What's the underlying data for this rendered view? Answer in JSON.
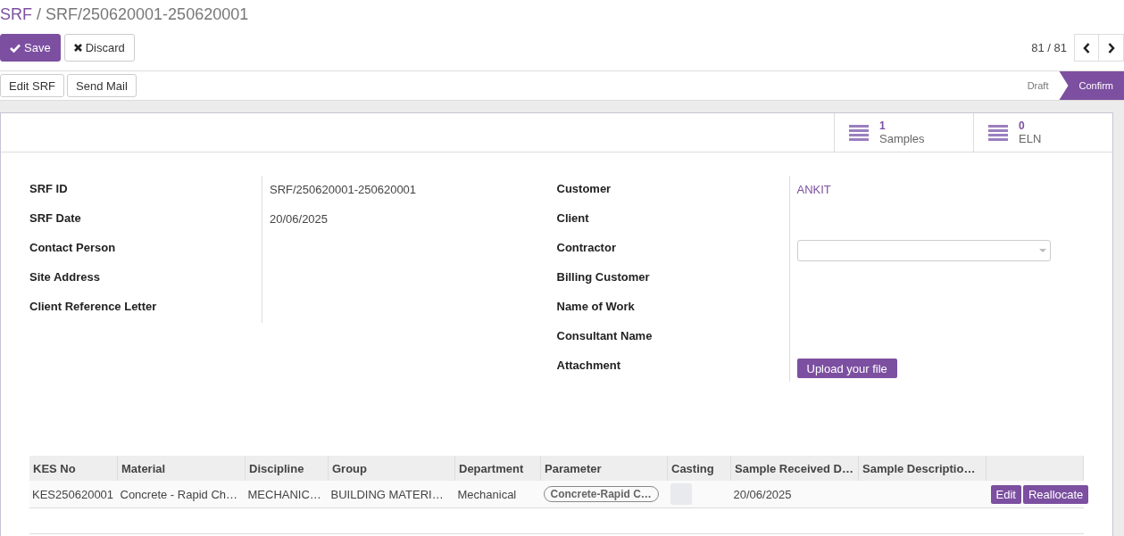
{
  "breadcrumb": {
    "parent": "SRF",
    "separator": "/",
    "current": "SRF/250620001-250620001"
  },
  "buttons": [
    {
      "kind": "primary",
      "label": "Save"
    },
    {
      "kind": "default",
      "label": "Discard"
    }
  ],
  "pager": {
    "counter": "81 / 81"
  },
  "actions": [
    "Edit SRF",
    "Send Mail"
  ],
  "stages": [
    {
      "label": "Draft",
      "selected": false
    },
    {
      "label": "Confirm",
      "selected": true
    }
  ],
  "stat_buttons": [
    {
      "value": "1",
      "label": "Samples"
    },
    {
      "value": "0",
      "label": "ELN"
    }
  ],
  "left_fields": [
    {
      "label": "SRF ID",
      "kind": "text",
      "value": "SRF/250620001-250620001"
    },
    {
      "label": "SRF Date",
      "kind": "text",
      "value": "20/06/2025"
    },
    {
      "label": "Contact Person",
      "kind": "empty"
    },
    {
      "label": "Site Address",
      "kind": "empty"
    },
    {
      "label": "Client Reference Letter",
      "kind": "empty"
    }
  ],
  "right_fields": [
    {
      "label": "Customer",
      "kind": "link",
      "value": "ANKIT"
    },
    {
      "label": "Client",
      "kind": "empty"
    },
    {
      "label": "Contractor",
      "kind": "select"
    },
    {
      "label": "Billing Customer",
      "kind": "empty"
    },
    {
      "label": "Name of Work",
      "kind": "empty"
    },
    {
      "label": "Consultant Name",
      "kind": "empty"
    },
    {
      "label": "Attachment",
      "kind": "upload",
      "value": "Upload your file"
    }
  ],
  "table": {
    "columns": [
      "KES No",
      "Material",
      "Discipline",
      "Group",
      "Department",
      "Parameter",
      "Casting",
      "Sample Received D…",
      "Sample Descriptio…"
    ],
    "rows": [
      {
        "cells": [
          {
            "kind": "text",
            "value": "KES250620001"
          },
          {
            "kind": "text",
            "value": "Concrete - Rapid Ch…"
          },
          {
            "kind": "text",
            "value": "MECHANIC…"
          },
          {
            "kind": "text",
            "value": "BUILDING MATERI…"
          },
          {
            "kind": "text",
            "value": "Mechanical"
          },
          {
            "kind": "tag",
            "value": "Concrete-Rapid C…"
          },
          {
            "kind": "box"
          },
          {
            "kind": "text",
            "value": "20/06/2025"
          },
          {
            "kind": "empty"
          }
        ],
        "buttons": [
          "Edit",
          "Reallocate"
        ]
      }
    ]
  }
}
